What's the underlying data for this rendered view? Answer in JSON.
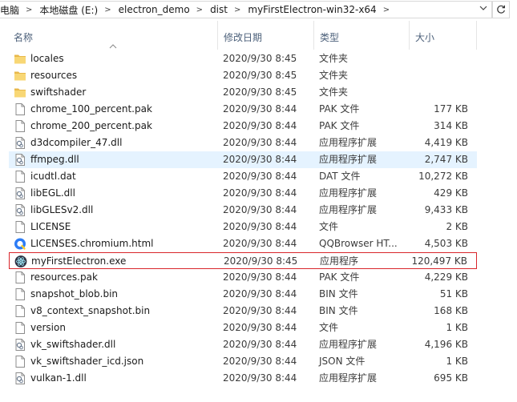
{
  "address": {
    "crumbs": [
      "电脑",
      "本地磁盘 (E:)",
      "electron_demo",
      "dist",
      "myFirstElectron-win32-x64"
    ]
  },
  "columns": {
    "name": "名称",
    "date": "修改日期",
    "type": "类型",
    "size": "大小"
  },
  "files": [
    {
      "name": "locales",
      "date": "2020/9/30 8:45",
      "type": "文件夹",
      "size": "",
      "icon": "folder-icon"
    },
    {
      "name": "resources",
      "date": "2020/9/30 8:45",
      "type": "文件夹",
      "size": "",
      "icon": "folder-icon"
    },
    {
      "name": "swiftshader",
      "date": "2020/9/30 8:45",
      "type": "文件夹",
      "size": "",
      "icon": "folder-icon"
    },
    {
      "name": "chrome_100_percent.pak",
      "date": "2020/9/30 8:44",
      "type": "PAK 文件",
      "size": "177 KB",
      "icon": "file-icon"
    },
    {
      "name": "chrome_200_percent.pak",
      "date": "2020/9/30 8:44",
      "type": "PAK 文件",
      "size": "314 KB",
      "icon": "file-icon"
    },
    {
      "name": "d3dcompiler_47.dll",
      "date": "2020/9/30 8:44",
      "type": "应用程序扩展",
      "size": "4,419 KB",
      "icon": "dll-icon"
    },
    {
      "name": "ffmpeg.dll",
      "date": "2020/9/30 8:44",
      "type": "应用程序扩展",
      "size": "2,747 KB",
      "icon": "dll-icon"
    },
    {
      "name": "icudtl.dat",
      "date": "2020/9/30 8:44",
      "type": "DAT 文件",
      "size": "10,272 KB",
      "icon": "file-icon"
    },
    {
      "name": "libEGL.dll",
      "date": "2020/9/30 8:44",
      "type": "应用程序扩展",
      "size": "429 KB",
      "icon": "dll-icon"
    },
    {
      "name": "libGLESv2.dll",
      "date": "2020/9/30 8:44",
      "type": "应用程序扩展",
      "size": "9,433 KB",
      "icon": "dll-icon"
    },
    {
      "name": "LICENSE",
      "date": "2020/9/30 8:44",
      "type": "文件",
      "size": "2 KB",
      "icon": "file-icon"
    },
    {
      "name": "LICENSES.chromium.html",
      "date": "2020/9/30 8:44",
      "type": "QQBrowser HT...",
      "size": "4,503 KB",
      "icon": "browser-icon"
    },
    {
      "name": "myFirstElectron.exe",
      "date": "2020/9/30 8:45",
      "type": "应用程序",
      "size": "120,497 KB",
      "icon": "electron-icon"
    },
    {
      "name": "resources.pak",
      "date": "2020/9/30 8:44",
      "type": "PAK 文件",
      "size": "4,229 KB",
      "icon": "file-icon"
    },
    {
      "name": "snapshot_blob.bin",
      "date": "2020/9/30 8:44",
      "type": "BIN 文件",
      "size": "51 KB",
      "icon": "file-icon"
    },
    {
      "name": "v8_context_snapshot.bin",
      "date": "2020/9/30 8:44",
      "type": "BIN 文件",
      "size": "168 KB",
      "icon": "file-icon"
    },
    {
      "name": "version",
      "date": "2020/9/30 8:44",
      "type": "文件",
      "size": "1 KB",
      "icon": "file-icon"
    },
    {
      "name": "vk_swiftshader.dll",
      "date": "2020/9/30 8:44",
      "type": "应用程序扩展",
      "size": "4,196 KB",
      "icon": "dll-icon"
    },
    {
      "name": "vk_swiftshader_icd.json",
      "date": "2020/9/30 8:44",
      "type": "JSON 文件",
      "size": "1 KB",
      "icon": "file-icon"
    },
    {
      "name": "vulkan-1.dll",
      "date": "2020/9/30 8:44",
      "type": "应用程序扩展",
      "size": "695 KB",
      "icon": "dll-icon"
    }
  ],
  "hovered_index": 6,
  "selected_index": 12,
  "colors": {
    "folder": "#f8d775",
    "hover": "#e5f3ff",
    "selection_border": "#d9252b",
    "header_text": "#4c607a"
  }
}
